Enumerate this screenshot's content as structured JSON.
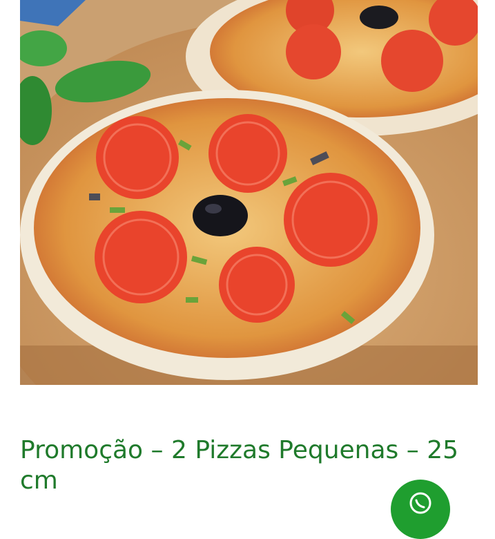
{
  "product": {
    "title": "Promoção – 2 Pizzas Pequenas – 25 cm",
    "image_icon": "pizza-photo"
  },
  "chat_button": {
    "icon": "whatsapp-icon",
    "color": "#1f9e2f"
  },
  "colors": {
    "title": "#1f7a2b"
  }
}
